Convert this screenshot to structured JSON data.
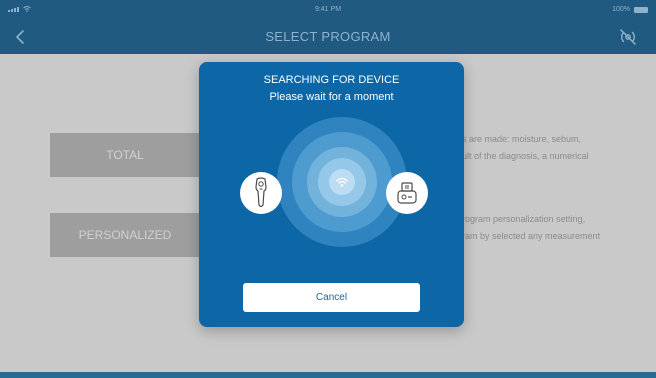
{
  "status_bar": {
    "time": "9:41 PM",
    "battery_text": "100%"
  },
  "nav": {
    "title": "SELECT PROGRAM",
    "back_icon": "chevron-left-icon",
    "connection_icon": "no-connection-icon"
  },
  "programs": [
    {
      "label": "TOTAL"
    },
    {
      "label": "PERSONALIZED"
    }
  ],
  "descriptions": {
    "total_line1": "s are made: moisture, sebum,",
    "total_line2": "ult of the diagnosis, a numerical",
    "personalized_line1": "rogram personalization setting,",
    "personalized_line2": "ram by selected any measurement"
  },
  "modal": {
    "title": "SEARCHING FOR DEVICE",
    "subtitle": "Please wait for a moment",
    "cancel_label": "Cancel",
    "left_device_icon": "handheld-scanner-icon",
    "right_device_icon": "device-case-icon",
    "center_icon": "wifi-icon"
  },
  "colors": {
    "nav_bg": "#215a80",
    "modal_bg": "#0d66a5",
    "overlay_bg": "#c9c9c9",
    "button_text": "#2a6592"
  }
}
